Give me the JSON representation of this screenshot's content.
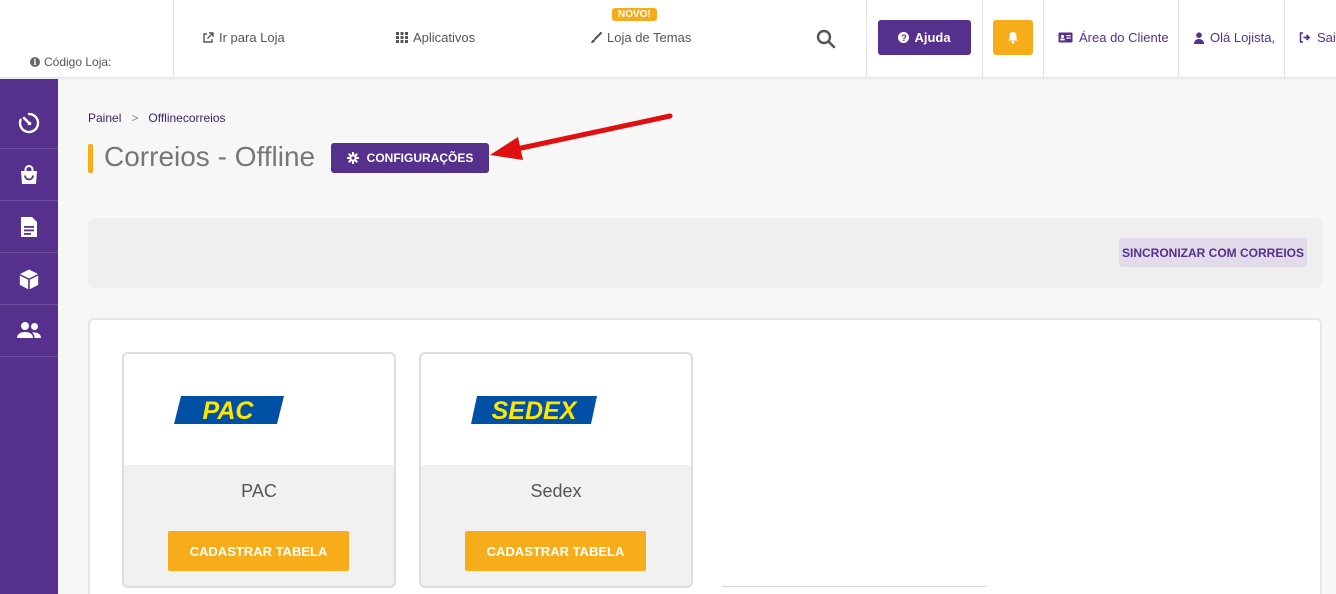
{
  "header": {
    "store_code_label": "Código Loja:",
    "nav": {
      "go_to_store": "Ir para Loja",
      "apps": "Aplicativos",
      "theme_store": "Loja de Temas",
      "new_badge": "NOVO!"
    },
    "help_label": "Ajuda",
    "client_area": "Área do Cliente",
    "greeting": "Olá Lojista,",
    "logout": "Sai"
  },
  "sidebar": {
    "items": [
      {
        "icon": "speedometer-icon"
      },
      {
        "icon": "shopping-bag-icon"
      },
      {
        "icon": "document-icon"
      },
      {
        "icon": "box-icon"
      },
      {
        "icon": "users-icon"
      }
    ]
  },
  "breadcrumb": {
    "items": [
      "Painel",
      "Offlinecorreios"
    ],
    "separator": ">"
  },
  "page": {
    "title": "Correios - Offline",
    "config_label": "CONFIGURAÇÕES",
    "sync_label": "SINCRONIZAR COM CORREIOS"
  },
  "services": [
    {
      "logo_text": "PAC",
      "name": "PAC",
      "button": "CADASTRAR TABELA"
    },
    {
      "logo_text": "SEDEX",
      "name": "Sedex",
      "button": "CADASTRAR TABELA"
    }
  ],
  "colors": {
    "brand_purple": "#55308c",
    "accent_orange": "#f7ac1a",
    "logo_blue": "#0051a5",
    "logo_yellow": "#ffe600",
    "annotation_red": "#e01010"
  }
}
